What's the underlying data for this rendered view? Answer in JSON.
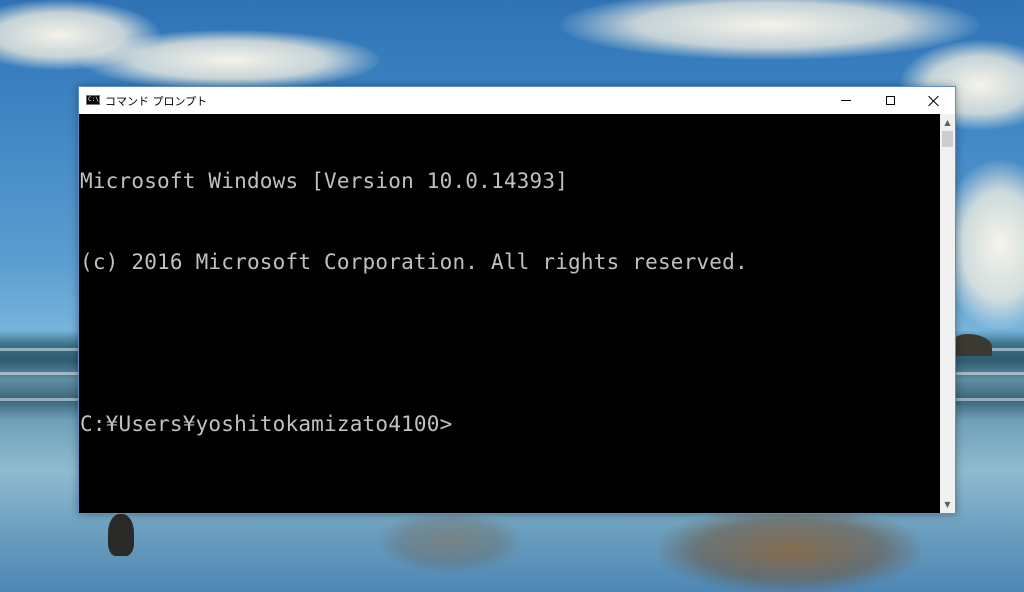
{
  "window": {
    "title": "コマンド プロンプト",
    "icon": "cmd-icon",
    "icon_text": "C:\\",
    "controls": {
      "minimize": "minimize-icon",
      "maximize": "maximize-icon",
      "close": "close-icon"
    }
  },
  "console": {
    "lines": [
      "Microsoft Windows [Version 10.0.14393]",
      "(c) 2016 Microsoft Corporation. All rights reserved.",
      "",
      "C:¥Users¥yoshitokamizato4100>"
    ],
    "background_color": "#000000",
    "text_color": "#c0c0c0"
  },
  "scrollbar": {
    "up_icon": "chevron-up-icon",
    "down_icon": "chevron-down-icon",
    "up_glyph": "▲",
    "down_glyph": "▼"
  }
}
